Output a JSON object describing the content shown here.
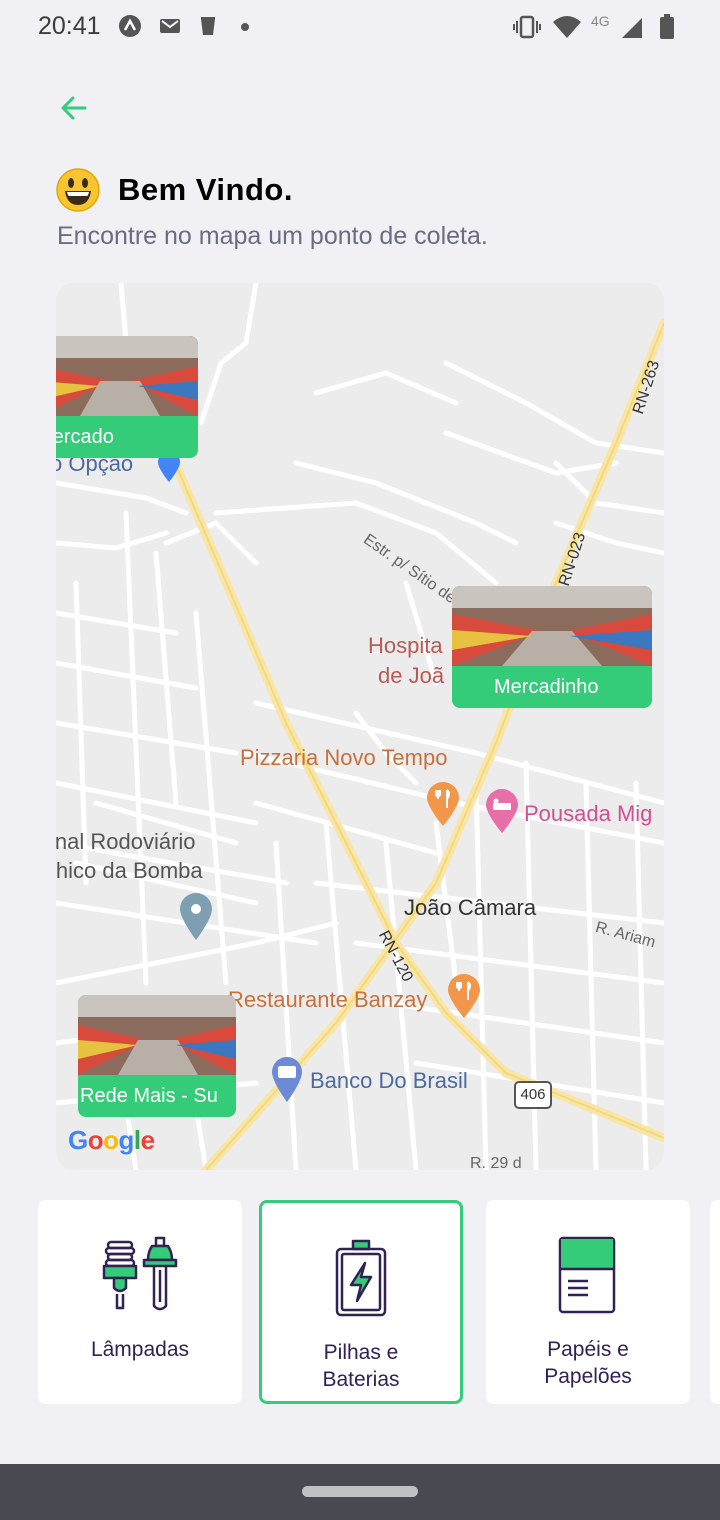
{
  "status_bar": {
    "time": "20:41",
    "network": "4G"
  },
  "header": {
    "title": "Bem Vindo.",
    "subtitle": "Encontre no mapa um ponto de coleta."
  },
  "map": {
    "markers": [
      {
        "name": "Mercado"
      },
      {
        "name": "Mercadinho"
      },
      {
        "name": "Rede Mais - Su"
      }
    ],
    "places": {
      "opcao": "o Opção",
      "hospital_1": "Hospita",
      "hospital_2": "de Joã",
      "pizzaria": "Pizzaria Novo Tempo",
      "pousada": "Pousada Mig",
      "rodoviario_1": "inal Rodoviário",
      "rodoviario_2": "Chico da Bomba",
      "joao_camara": "João Câmara",
      "restaurante": "Restaurante Banzay",
      "banco": "Banco Do Brasil",
      "estr": "Estr. p/ Sítio de S",
      "rn023": "RN-023",
      "rn263": "RN-263",
      "rn120": "RN-120",
      "r_ariam": "R. Ariam",
      "r_29": "R. 29 d",
      "shield_406": "406"
    },
    "attribution": "Google"
  },
  "items": [
    {
      "label_1": "Lâmpadas",
      "label_2": "",
      "icon": "lamps-icon",
      "selected": false
    },
    {
      "label_1": "Pilhas e",
      "label_2": "Baterias",
      "icon": "battery-icon",
      "selected": true
    },
    {
      "label_1": "Papéis e",
      "label_2": "Papelões",
      "icon": "paper-icon",
      "selected": false
    }
  ],
  "colors": {
    "primary": "#34cb79",
    "text": "#322153",
    "background": "#f0f0f5"
  }
}
